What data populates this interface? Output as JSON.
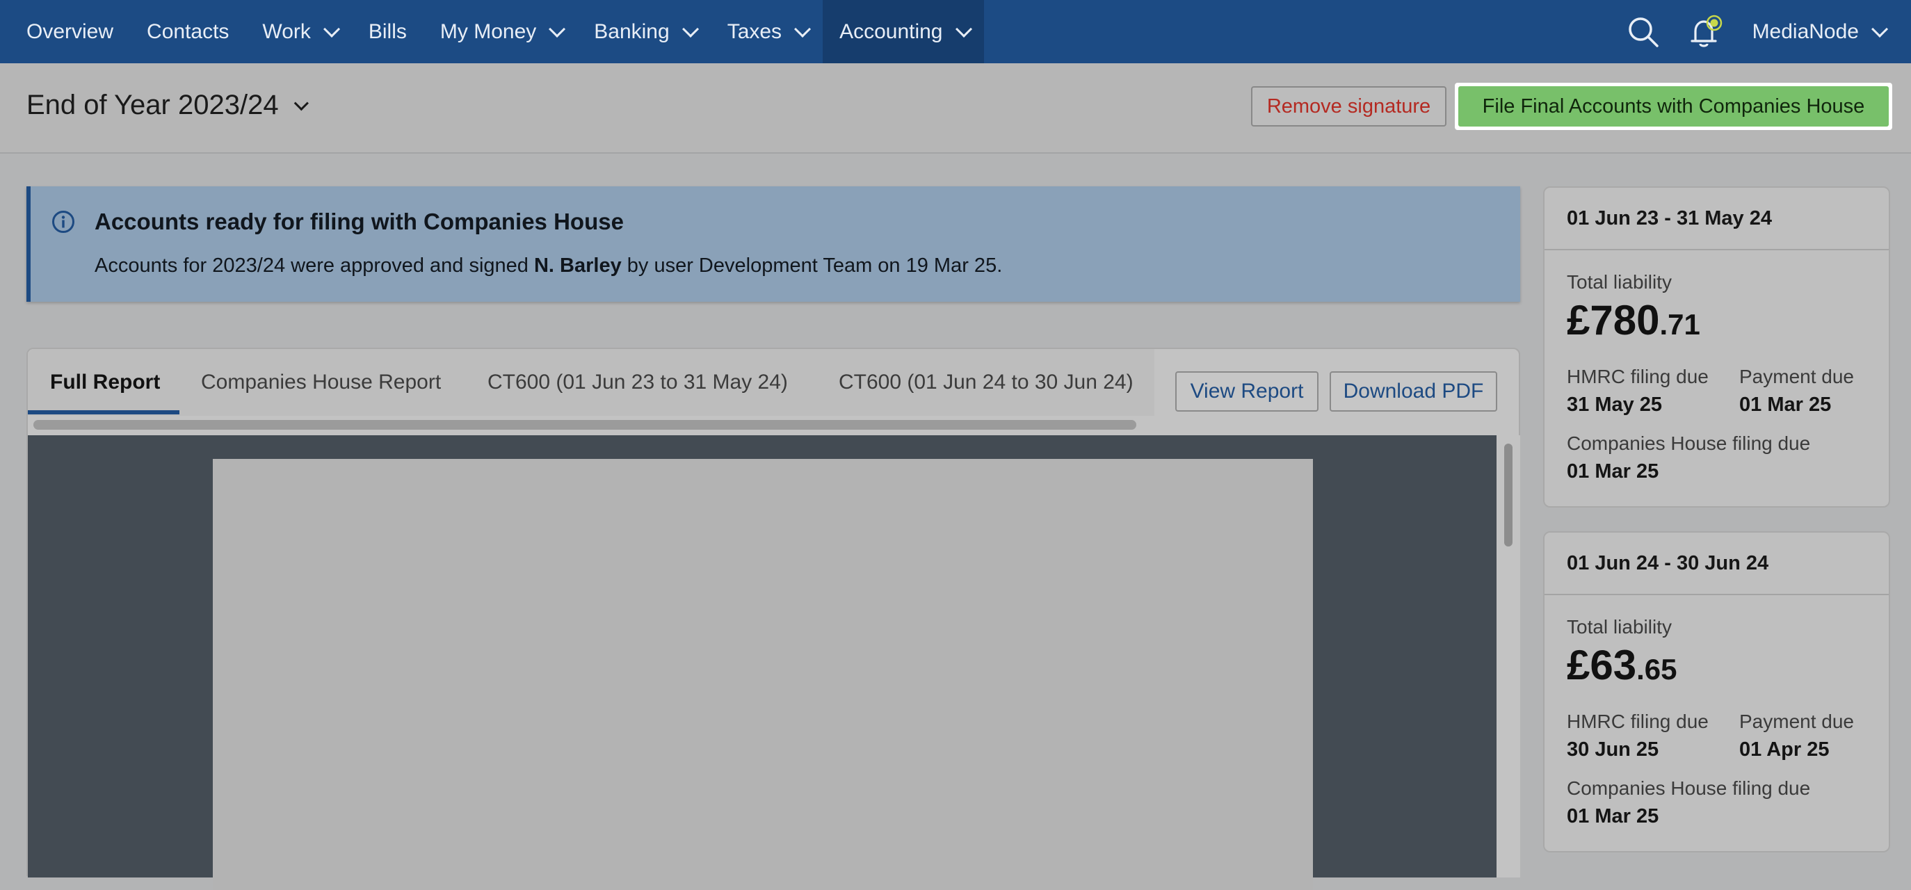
{
  "nav": {
    "items": [
      {
        "label": "Overview",
        "dropdown": false
      },
      {
        "label": "Contacts",
        "dropdown": false
      },
      {
        "label": "Work",
        "dropdown": true
      },
      {
        "label": "Bills",
        "dropdown": false
      },
      {
        "label": "My Money",
        "dropdown": true
      },
      {
        "label": "Banking",
        "dropdown": true
      },
      {
        "label": "Taxes",
        "dropdown": true
      },
      {
        "label": "Accounting",
        "dropdown": true,
        "active": true
      }
    ],
    "user": "MediaNode",
    "icons": [
      "search-icon",
      "bell-icon",
      "chevron-down-icon"
    ],
    "colors": {
      "bar": "#1c4b84",
      "active": "#163d6d",
      "notification": "#c8d84a"
    }
  },
  "header": {
    "title": "End of Year 2023/24",
    "remove_signature": "Remove signature",
    "file_accounts": "File Final Accounts with Companies House",
    "colors": {
      "remove": "#b42a22",
      "file": "#78c06a"
    }
  },
  "alert": {
    "title": "Accounts ready for filing with Companies House",
    "text_before": "Accounts for 2023/24 were approved and signed ",
    "signer": "N. Barley",
    "text_after": " by user Development Team on 19 Mar 25.",
    "icon": "info-icon"
  },
  "report": {
    "tabs": [
      {
        "label": "Full Report",
        "active": true
      },
      {
        "label": "Companies House Report"
      },
      {
        "label": "CT600 (01 Jun 23 to 31 May 24)"
      },
      {
        "label": "CT600 (01 Jun 24 to 30 Jun 24)"
      }
    ],
    "view_report": "View Report",
    "download_pdf": "Download PDF"
  },
  "periods": [
    {
      "range": "01 Jun 23 - 31 May 24",
      "total_liability_label": "Total liability",
      "amount_main": "£780",
      "amount_fraction": ".71",
      "hmrc_label": "HMRC filing due",
      "hmrc_date": "31 May 25",
      "payment_label": "Payment due",
      "payment_date": "01 Mar 25",
      "ch_label": "Companies House filing due",
      "ch_date": "01 Mar 25"
    },
    {
      "range": "01 Jun 24 - 30 Jun 24",
      "total_liability_label": "Total liability",
      "amount_main": "£63",
      "amount_fraction": ".65",
      "hmrc_label": "HMRC filing due",
      "hmrc_date": "30 Jun 25",
      "payment_label": "Payment due",
      "payment_date": "01 Apr 25",
      "ch_label": "Companies House filing due",
      "ch_date": "01 Mar 25"
    }
  ]
}
